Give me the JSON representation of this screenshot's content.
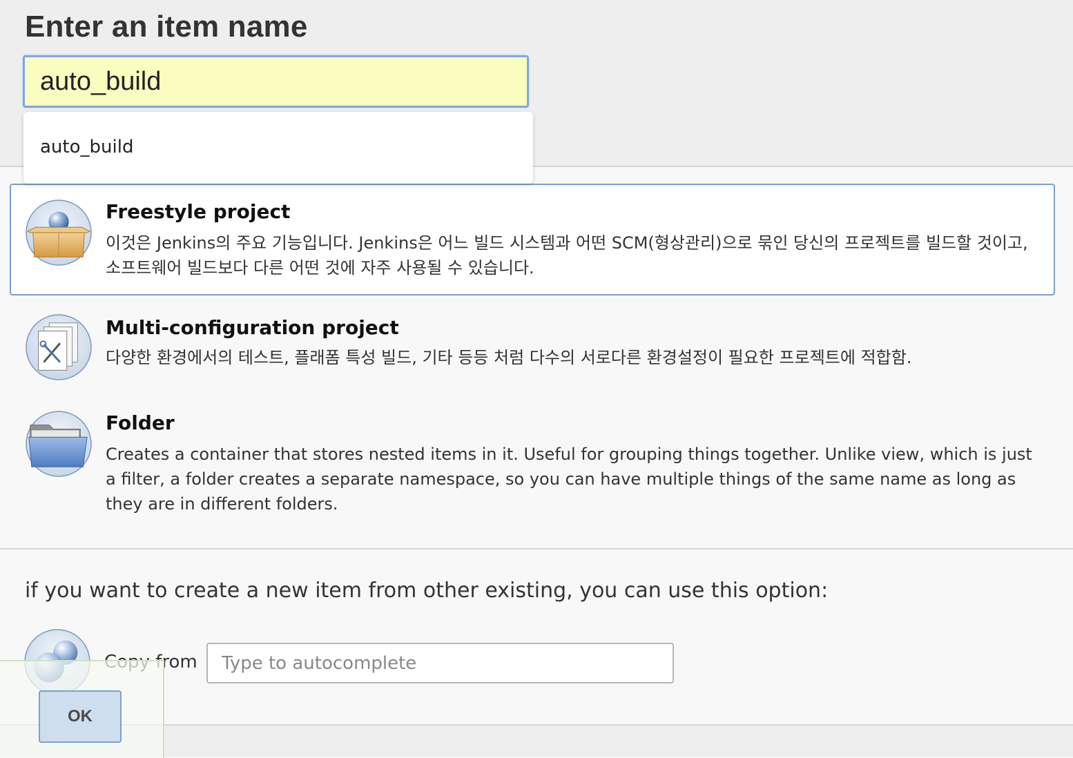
{
  "page": {
    "title": "Enter an item name"
  },
  "name_input": {
    "value": "auto_build",
    "suggestions": [
      "auto_build"
    ]
  },
  "item_types": [
    {
      "label": "Freestyle project",
      "description": "이것은 Jenkins의 주요 기능입니다. Jenkins은 어느 빌드 시스템과 어떤 SCM(형상관리)으로 묶인 당신의 프로젝트를 빌드할 것이고, 소프트웨어 빌드보다 다른 어떤 것에 자주 사용될 수 있습니다.",
      "icon": "freestyle-box-icon",
      "selected": true
    },
    {
      "label": "Multi-configuration project",
      "description": "다양한 환경에서의 테스트, 플래폼 특성 빌드, 기타 등등 처럼 다수의 서로다른 환경설정이 필요한 프로젝트에 적합함.",
      "icon": "multi-config-tools-icon",
      "selected": false
    },
    {
      "label": "Folder",
      "description": "Creates a container that stores nested items in it. Useful for grouping things together. Unlike view, which is just a filter, a folder creates a separate namespace, so you can have multiple things of the same name as long as they are in different folders.",
      "icon": "folder-icon",
      "selected": false
    }
  ],
  "copy_section": {
    "hint": "if you want to create a new item from other existing, you can use this option:",
    "label": "Copy from",
    "placeholder": "Type to autocomplete",
    "icon": "copy-item-icon"
  },
  "actions": {
    "ok_label": "OK"
  },
  "colors": {
    "name_input_bg": "#fafcc0",
    "name_input_border": "#82a8e0",
    "selected_border": "#7b9fcb",
    "ok_button_bg": "#cfdeef"
  }
}
